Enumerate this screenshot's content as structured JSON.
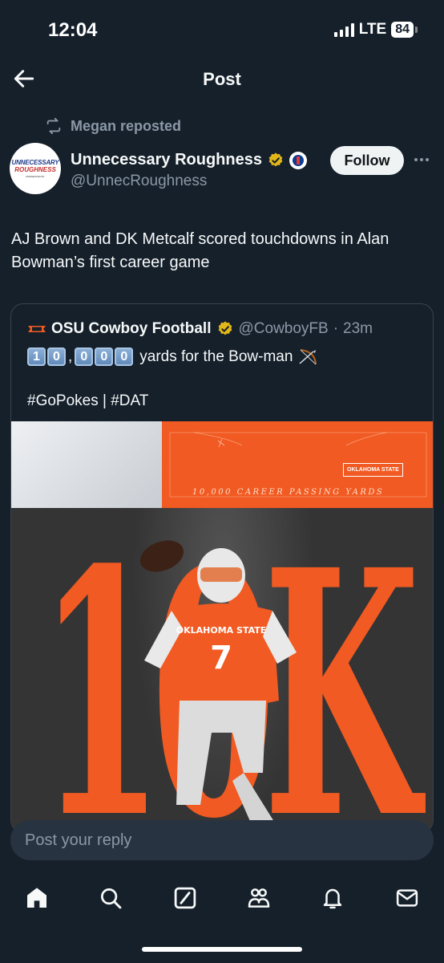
{
  "status": {
    "time": "12:04",
    "network": "LTE",
    "battery": "84"
  },
  "nav": {
    "title": "Post"
  },
  "repost": {
    "text": "Megan reposted"
  },
  "author": {
    "name": "Unnecessary Roughness",
    "handle": "@UnnecRoughness",
    "avatar_line1": "UNNECESSARY",
    "avatar_line2": "ROUGHNESS",
    "avatar_line3": "PRESENTED BY"
  },
  "follow_label": "Follow",
  "post_text": "AJ Brown and DK Metcalf scored touchdowns in Alan Bowman’s first career game",
  "quote": {
    "name": "OSU Cowboy Football",
    "handle": "@CowboyFB",
    "sep": "·",
    "time": "23m",
    "keycaps": [
      "1",
      "0",
      "0",
      "0",
      "0"
    ],
    "comma": ",",
    "text": "yards for the Bow-man",
    "tags": "#GoPokes | #DAT",
    "graphic": {
      "label": "10,000 CAREER PASSING YARDS",
      "big_text": "10K",
      "osu_line1": "OKLAHOMA STATE",
      "osu_line2": "",
      "jersey_number": "7",
      "jersey_text": "OKLAHOMA STATE"
    }
  },
  "reply": {
    "placeholder": "Post your reply"
  },
  "tabs": [
    "home-icon",
    "search-icon",
    "grok-icon",
    "communities-icon",
    "notifications-icon",
    "messages-icon"
  ],
  "colors": {
    "background": "#15202b",
    "accent_orange": "#f15a22",
    "muted": "#8b98a5",
    "verified": "#e2b719"
  }
}
